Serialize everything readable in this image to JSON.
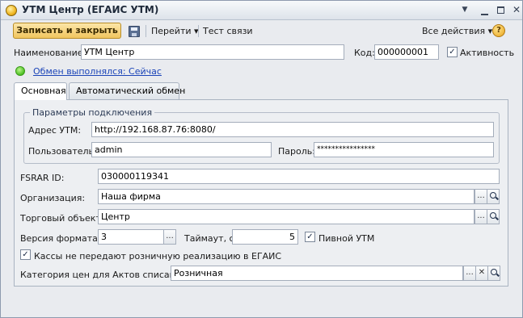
{
  "window": {
    "title": "УТМ Центр (ЕГАИС УТМ)",
    "menu_glyph": "▼",
    "min_glyph": "",
    "max_glyph": "",
    "close_glyph": "✕"
  },
  "toolbar": {
    "save_close_label": "Записать и закрыть",
    "goto_label": "Перейти",
    "test_label": "Тест связи",
    "all_actions_label": "Все действия",
    "dropdown_glyph": "▾",
    "help_glyph": "?"
  },
  "header": {
    "name_label": "Наименование:",
    "name_value": "УТМ Центр",
    "code_label": "Код:",
    "code_value": "000000001",
    "active_label": "Активность",
    "active_checked": true
  },
  "status": {
    "exchange_text": "Обмен выполнялся: Сейчас",
    "color": "#4cbf23"
  },
  "tabs": [
    {
      "label": "Основная",
      "active": true
    },
    {
      "label": "Автоматический обмен",
      "active": false
    }
  ],
  "connection": {
    "group_title": "Параметры подключения",
    "address_label": "Адрес УТМ:",
    "address_value": "http://192.168.87.76:8080/",
    "user_label": "Пользователь:",
    "user_value": "admin",
    "password_label": "Пароль:",
    "password_value": "****************"
  },
  "form": {
    "fsrar_label": "FSRAR ID:",
    "fsrar_value": "030000119341",
    "org_label": "Организация:",
    "org_value": "Наша фирма",
    "store_label": "Торговый объект:",
    "store_value": "Центр",
    "format_label": "Версия формата:",
    "format_value": "3",
    "timeout_label": "Таймаут, с:",
    "timeout_value": "5",
    "beer_label": "Пивной УТМ",
    "beer_checked": true,
    "cash_label": "Кассы не передают розничную реализацию в ЕГАИС",
    "cash_checked": true,
    "price_cat_label": "Категория цен для Актов списания:",
    "price_cat_value": "Розничная",
    "select_glyph": "...",
    "clear_glyph": "✕",
    "check_glyph": "✓"
  },
  "colors": {
    "accent_button": "#f1c55f",
    "link": "#1b44b8",
    "window_bg": "#e9ebef"
  }
}
